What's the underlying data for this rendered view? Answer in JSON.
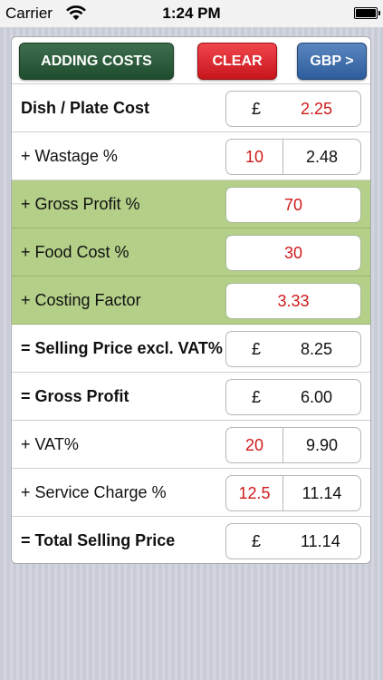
{
  "status": {
    "carrier": "Carrier",
    "time": "1:24 PM"
  },
  "toolbar": {
    "adding_costs": "ADDING COSTS",
    "clear": "CLEAR",
    "currency": "GBP >"
  },
  "rows": {
    "dish_cost": {
      "label": "Dish / Plate Cost",
      "symbol": "£",
      "value": "2.25"
    },
    "wastage": {
      "label": "+ Wastage %",
      "percent": "10",
      "value": "2.48"
    },
    "gross_profit_pct": {
      "label": "+  Gross Profit %",
      "value": "70"
    },
    "food_cost_pct": {
      "label": "+  Food Cost %",
      "value": "30"
    },
    "costing_factor": {
      "label": "+  Costing Factor",
      "value": "3.33"
    },
    "selling_price_excl": {
      "label": "= Selling Price excl. VAT%",
      "symbol": "£",
      "value": "8.25"
    },
    "gross_profit": {
      "label": "= Gross Profit",
      "symbol": "£",
      "value": "6.00"
    },
    "vat": {
      "label": "+ VAT%",
      "percent": "20",
      "value": "9.90"
    },
    "service_charge": {
      "label": "+ Service Charge %",
      "percent": "12.5",
      "value": "11.14"
    },
    "total_selling_price": {
      "label": "= Total Selling Price",
      "symbol": "£",
      "value": "11.14"
    }
  },
  "colors": {
    "input_red": "#d11a1a",
    "green_row": "#b3cf88",
    "adding_btn": "#1d4d2d",
    "clear_btn": "#c8151c",
    "gbp_btn": "#2e5d9c"
  }
}
